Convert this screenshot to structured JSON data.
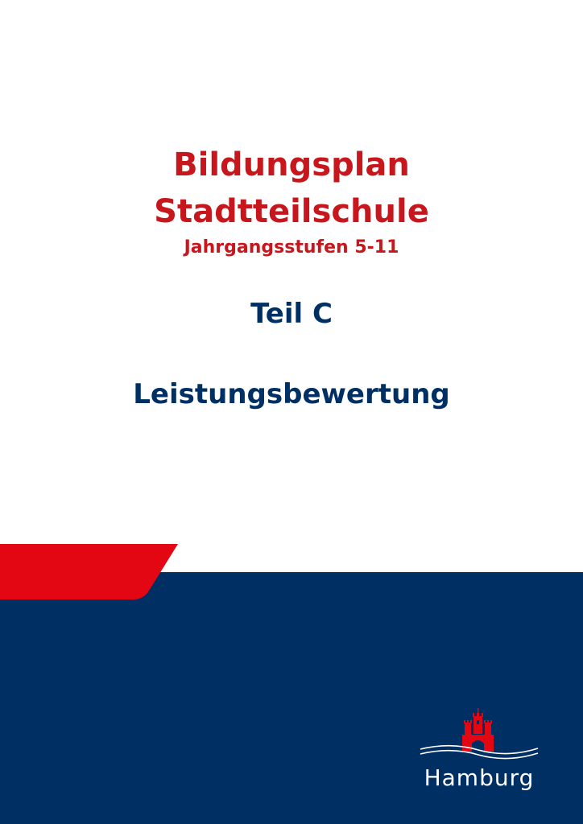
{
  "cover": {
    "title_line1": "Bildungsplan",
    "title_line2": "Stadtteilschule",
    "subtitle": "Jahrgangsstufen 5-11",
    "part": "Teil C",
    "topic": "Leistungsbewertung"
  },
  "logo": {
    "icon": "hamburg-castle-icon",
    "name": "Hamburg"
  },
  "colors": {
    "red": "#c8161d",
    "bright_red": "#e30613",
    "navy": "#003063",
    "background": "#ffffff"
  }
}
